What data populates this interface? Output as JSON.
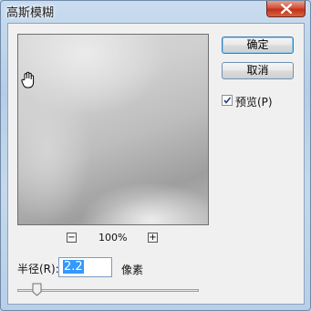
{
  "window": {
    "title": "高斯模糊"
  },
  "preview": {
    "zoom": "100%",
    "zoom_out": "−",
    "zoom_in": "+"
  },
  "buttons": {
    "ok": "确定",
    "cancel": "取消"
  },
  "preview_option": {
    "label": "预览(P)",
    "checked": true
  },
  "radius": {
    "label": "半径(R):",
    "value": "2.2",
    "unit": "像素",
    "slider_fraction": 0.02
  },
  "colors": {
    "selection": "#3399ff",
    "close": "#c0311a"
  }
}
